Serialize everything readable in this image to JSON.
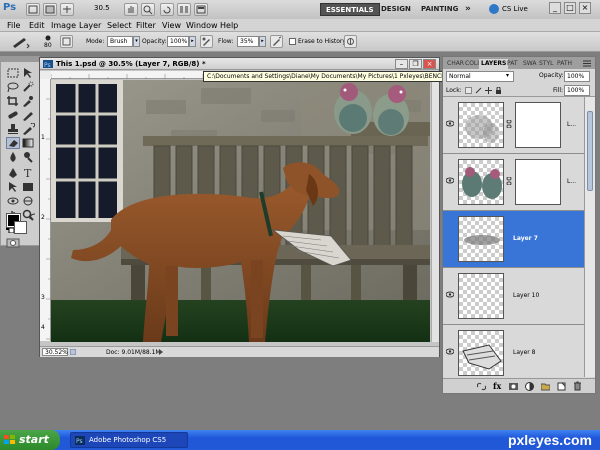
{
  "app": {
    "logo": "Ps",
    "zoom_value": "30.5",
    "workspaces": [
      "ESSENTIALS",
      "DESIGN",
      "PAINTING"
    ],
    "more": "»",
    "cs_live": "CS Live",
    "win_controls": [
      "_",
      "□",
      "×"
    ]
  },
  "menus": [
    "File",
    "Edit",
    "Image",
    "Layer",
    "Select",
    "Filter",
    "View",
    "Window",
    "Help"
  ],
  "options": {
    "brush_size": "80",
    "mode_label": "Mode:",
    "mode_value": "Brush",
    "opacity_label": "Opacity:",
    "opacity_value": "100%",
    "flow_label": "Flow:",
    "flow_value": "35%",
    "erase_history": "Erase to History"
  },
  "document": {
    "title": "This 1.psd @ 30.5% (Layer 7, RGB/8) *",
    "tooltip": "C:\\Documents and Settings\\Diane\\My Documents\\My Pictures\\1 Pxleyes\\BENCH\\This 1.psd @ 30.5% (Layer 7, RGB/8) *",
    "zoom": "30.52%",
    "doc_size": "Doc: 9.01M/88.1M",
    "ruler_left": [
      "1",
      "2",
      "3",
      "4"
    ]
  },
  "layers_panel": {
    "tabs": [
      "CHAR",
      "COLI",
      "LAYERS",
      "PAT",
      "SWA",
      "STYL",
      "PATH"
    ],
    "blend_mode": "Normal",
    "opacity_label": "Opacity:",
    "opacity_value": "100%",
    "lock_label": "Lock:",
    "fill_label": "Fill:",
    "fill_value": "100%",
    "layers": [
      {
        "name": "L...",
        "selected": false,
        "thumb": "white-blur"
      },
      {
        "name": "L...",
        "selected": false,
        "thumb": "birds"
      },
      {
        "name": "Layer 7",
        "selected": true,
        "thumb": "newspaper-smudge"
      },
      {
        "name": "Layer 10",
        "selected": false,
        "thumb": "empty"
      },
      {
        "name": "Layer 8",
        "selected": false,
        "thumb": "newspaper"
      }
    ]
  },
  "taskbar": {
    "start": "start",
    "task": "Adobe Photoshop CS5",
    "watermark": "pxleyes.com"
  },
  "colors": {
    "selection": "#3875d7",
    "workspace_active": "#545454",
    "taskbar": "#2259d6",
    "start_green": "#3a9a39"
  }
}
